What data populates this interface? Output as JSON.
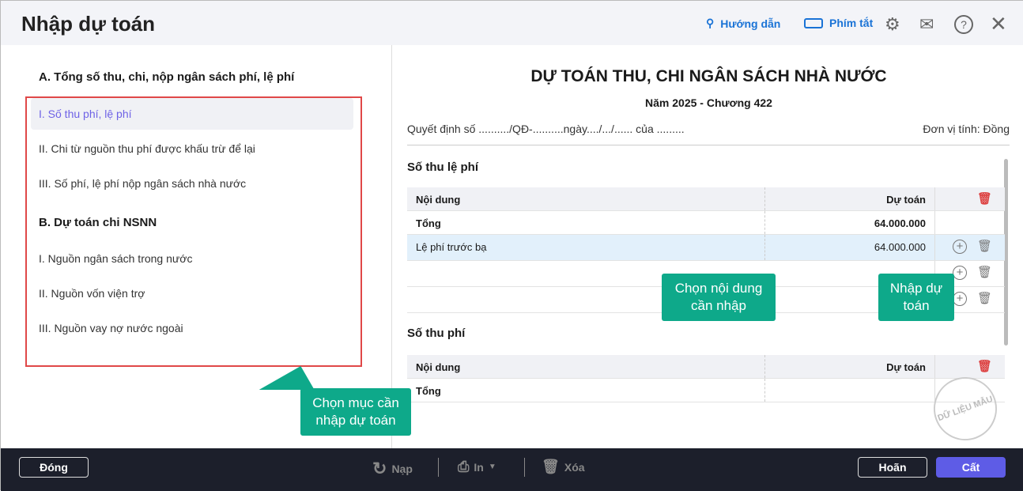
{
  "header": {
    "title": "Nhập dự toán",
    "guide_label": "Hướng dẫn",
    "shortcut_label": "Phím tắt"
  },
  "left": {
    "section_a": "A. Tổng số thu, chi, nộp ngân sách phí, lệ phí",
    "items_a": [
      "I. Số thu phí, lệ phí",
      "II. Chi từ nguồn thu phí được khấu trừ để lại",
      "III. Số phí, lệ phí nộp ngân sách nhà nước"
    ],
    "section_b": "B. Dự toán chi NSNN",
    "items_b": [
      "I. Nguồn ngân sách trong nước",
      "II. Nguồn vốn viện trợ",
      "III. Nguồn vay nợ nước ngoài"
    ]
  },
  "doc": {
    "title": "DỰ TOÁN THU, CHI NGÂN SÁCH NHÀ NƯỚC",
    "subtitle": "Năm 2025 - Chương 422",
    "decision": "Quyết định số ........../QĐ-..........ngày..../.../...... của .........",
    "unit": "Đơn vị tính: Đồng",
    "table1": {
      "heading": "Số thu lệ phí",
      "col1": "Nội dung",
      "col2": "Dự toán",
      "total_label": "Tổng",
      "total_value": "64.000.000",
      "rows": [
        {
          "name": "Lệ phí trước bạ",
          "value": "64.000.000"
        }
      ]
    },
    "table2": {
      "heading": "Số thu phí",
      "col1": "Nội dung",
      "col2": "Dự toán",
      "total_label": "Tổng"
    }
  },
  "callouts": {
    "select_item": "Chọn mục cần nhập dự toán",
    "select_content": "Chọn nội dung cần nhập",
    "enter_estimate": "Nhập dự toán"
  },
  "watermark": "DỮ LIỆU MẪU",
  "footer": {
    "close": "Đóng",
    "reload": "Nạp",
    "print": "In",
    "delete": "Xóa",
    "cancel": "Hoãn",
    "save": "Cất"
  },
  "colors": {
    "accent": "#6e62e6",
    "callout": "#0ea98a",
    "link": "#1a73d6"
  }
}
